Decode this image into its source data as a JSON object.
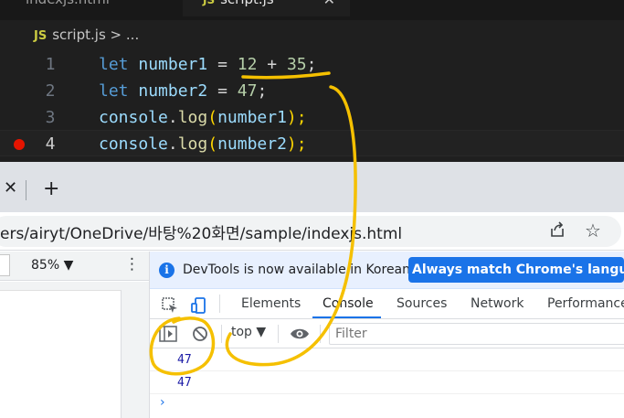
{
  "editor": {
    "tabs": [
      {
        "label": "indexjs.html"
      },
      {
        "label": "script.js",
        "js_badge": "JS",
        "close": "✕"
      }
    ],
    "breadcrumb": {
      "badge": "JS",
      "file": "script.js",
      "sep": ">",
      "more": "..."
    },
    "lines": [
      {
        "num": "1",
        "parts": [
          "let",
          "number1",
          "=",
          "12",
          "+",
          "35",
          ";"
        ]
      },
      {
        "num": "2",
        "parts": [
          "let",
          "number2",
          "=",
          "47",
          ";"
        ]
      },
      {
        "num": "3",
        "parts": [
          "console",
          ".",
          "log",
          "(",
          "number1",
          ");"
        ]
      },
      {
        "num": "4",
        "parts": [
          "console",
          ".",
          "log",
          "(",
          "number2",
          ");"
        ],
        "breakpoint": true
      }
    ],
    "colors": {
      "background": "#1f1f1f",
      "breakpoint": "#e51400",
      "keyword": "#569cd6",
      "variable": "#9cdcfe",
      "number": "#b5cea8"
    }
  },
  "browser": {
    "tabstrip": {
      "close": "✕",
      "new_tab": "+"
    },
    "url": {
      "prefix": "ers/airyt/OneDrive/바탕%20화면/sample/",
      "file": "indexjs.html"
    },
    "icons": {
      "share": "share-icon",
      "bookmark": "star-icon"
    },
    "device_toolbar": {
      "zoom": "85% ▼",
      "more": "⋮"
    }
  },
  "devtools": {
    "info": {
      "icon": "i",
      "text": "DevTools is now available in Korean!",
      "button": "Always match Chrome's language"
    },
    "tabs": [
      "Elements",
      "Console",
      "Sources",
      "Network",
      "Performance"
    ],
    "active_tab": "Console",
    "console_toolbar": {
      "context": "top ▼",
      "filter_placeholder": "Filter"
    },
    "logs": [
      "47",
      "47"
    ],
    "prompt": "›",
    "accent": "#1a73e8"
  }
}
